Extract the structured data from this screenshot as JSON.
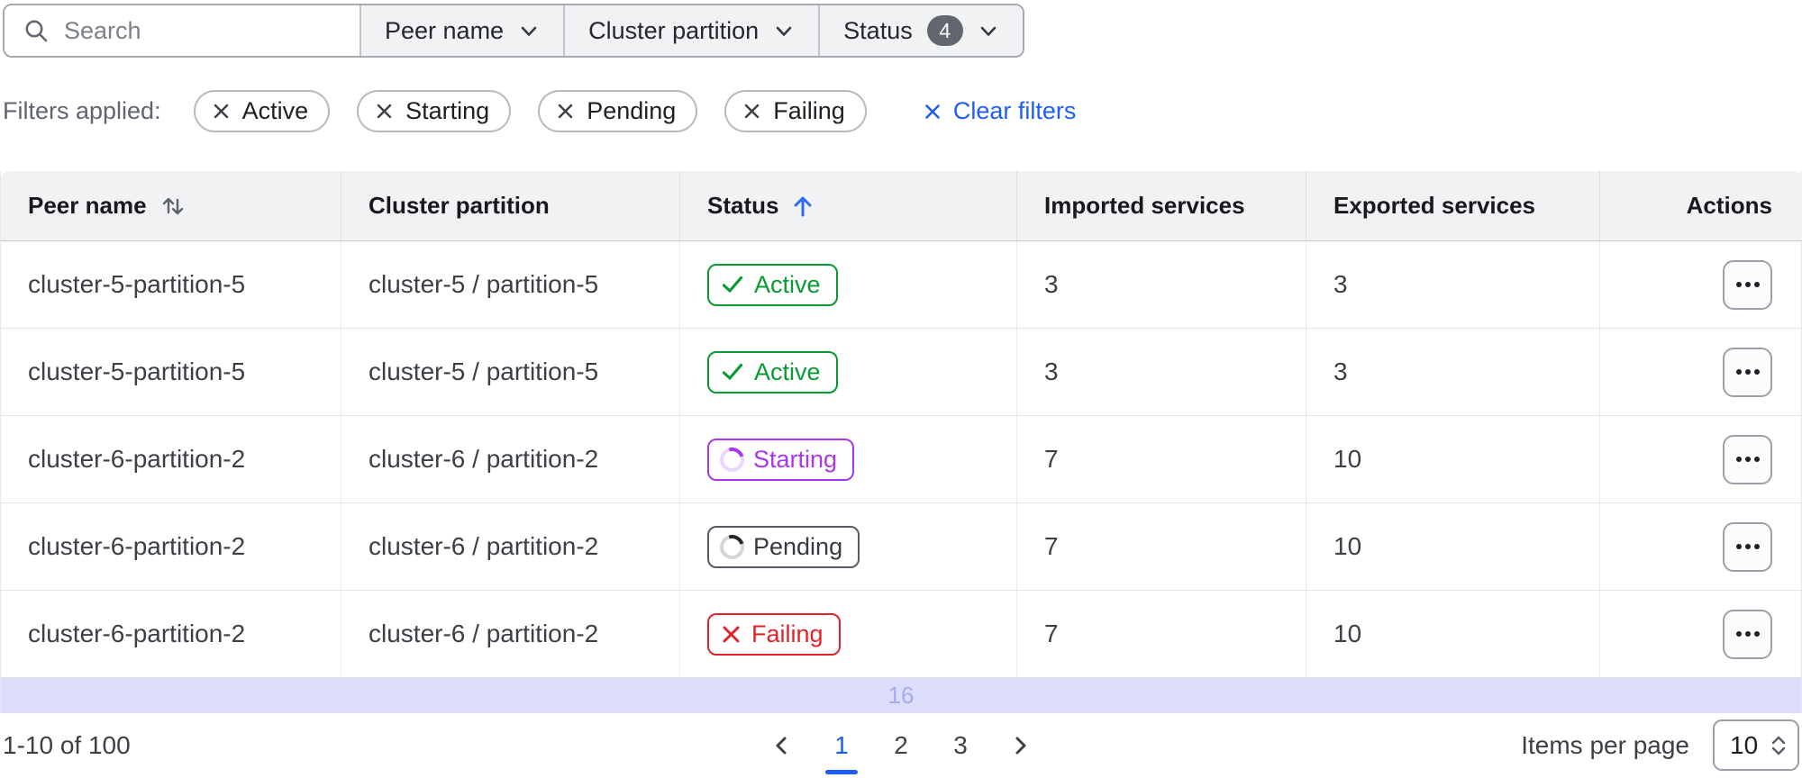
{
  "toolbar": {
    "search_placeholder": "Search",
    "filters": [
      {
        "label": "Peer name"
      },
      {
        "label": "Cluster partition"
      },
      {
        "label": "Status",
        "count": "4"
      }
    ]
  },
  "applied_filters": {
    "label": "Filters applied:",
    "chips": [
      "Active",
      "Starting",
      "Pending",
      "Failing"
    ],
    "clear_label": "Clear filters"
  },
  "table": {
    "columns": [
      "Peer name",
      "Cluster partition",
      "Status",
      "Imported services",
      "Exported services",
      "Actions"
    ],
    "sort": {
      "peer_name": "unsorted",
      "status": "ascending"
    },
    "rows": [
      {
        "peer": "cluster-5-partition-5",
        "partition": "cluster-5 / partition-5",
        "status_label": "Active",
        "status_kind": "active",
        "imported": "3",
        "exported": "3"
      },
      {
        "peer": "cluster-5-partition-5",
        "partition": "cluster-5 / partition-5",
        "status_label": "Active",
        "status_kind": "active",
        "imported": "3",
        "exported": "3"
      },
      {
        "peer": "cluster-6-partition-2",
        "partition": "cluster-6 / partition-2",
        "status_label": "Starting",
        "status_kind": "starting",
        "imported": "7",
        "exported": "10"
      },
      {
        "peer": "cluster-6-partition-2",
        "partition": "cluster-6 / partition-2",
        "status_label": "Pending",
        "status_kind": "pending",
        "imported": "7",
        "exported": "10"
      },
      {
        "peer": "cluster-6-partition-2",
        "partition": "cluster-6 / partition-2",
        "status_label": "Failing",
        "status_kind": "failing",
        "imported": "7",
        "exported": "10"
      }
    ],
    "band_text": "16"
  },
  "pagination": {
    "range": "1-10 of 100",
    "pages": [
      "1",
      "2",
      "3"
    ],
    "active_page": "1",
    "items_per_page_label": "Items per page",
    "items_per_page_value": "10"
  },
  "icons": {
    "search": "magnifier",
    "dropdown": "chevron-down",
    "chip_remove": "x-mark",
    "sort_unsorted": "arrow-up-down",
    "sort_ascending": "arrow-up",
    "status_active": "check",
    "status_loading": "spinner",
    "status_failing": "x-mark",
    "row_actions": "ellipsis",
    "page_prev": "chevron-left",
    "page_next": "chevron-right",
    "per_page": "chevrons-up-down"
  },
  "colors": {
    "accent-blue": "#1f5ef3",
    "success-green": "#089b33",
    "starting-purple": "#a737f0",
    "failing-red": "#e3232b",
    "band-bg": "#dcdefb",
    "band-text": "#a6abf0",
    "count-badge-bg": "#61666f"
  }
}
